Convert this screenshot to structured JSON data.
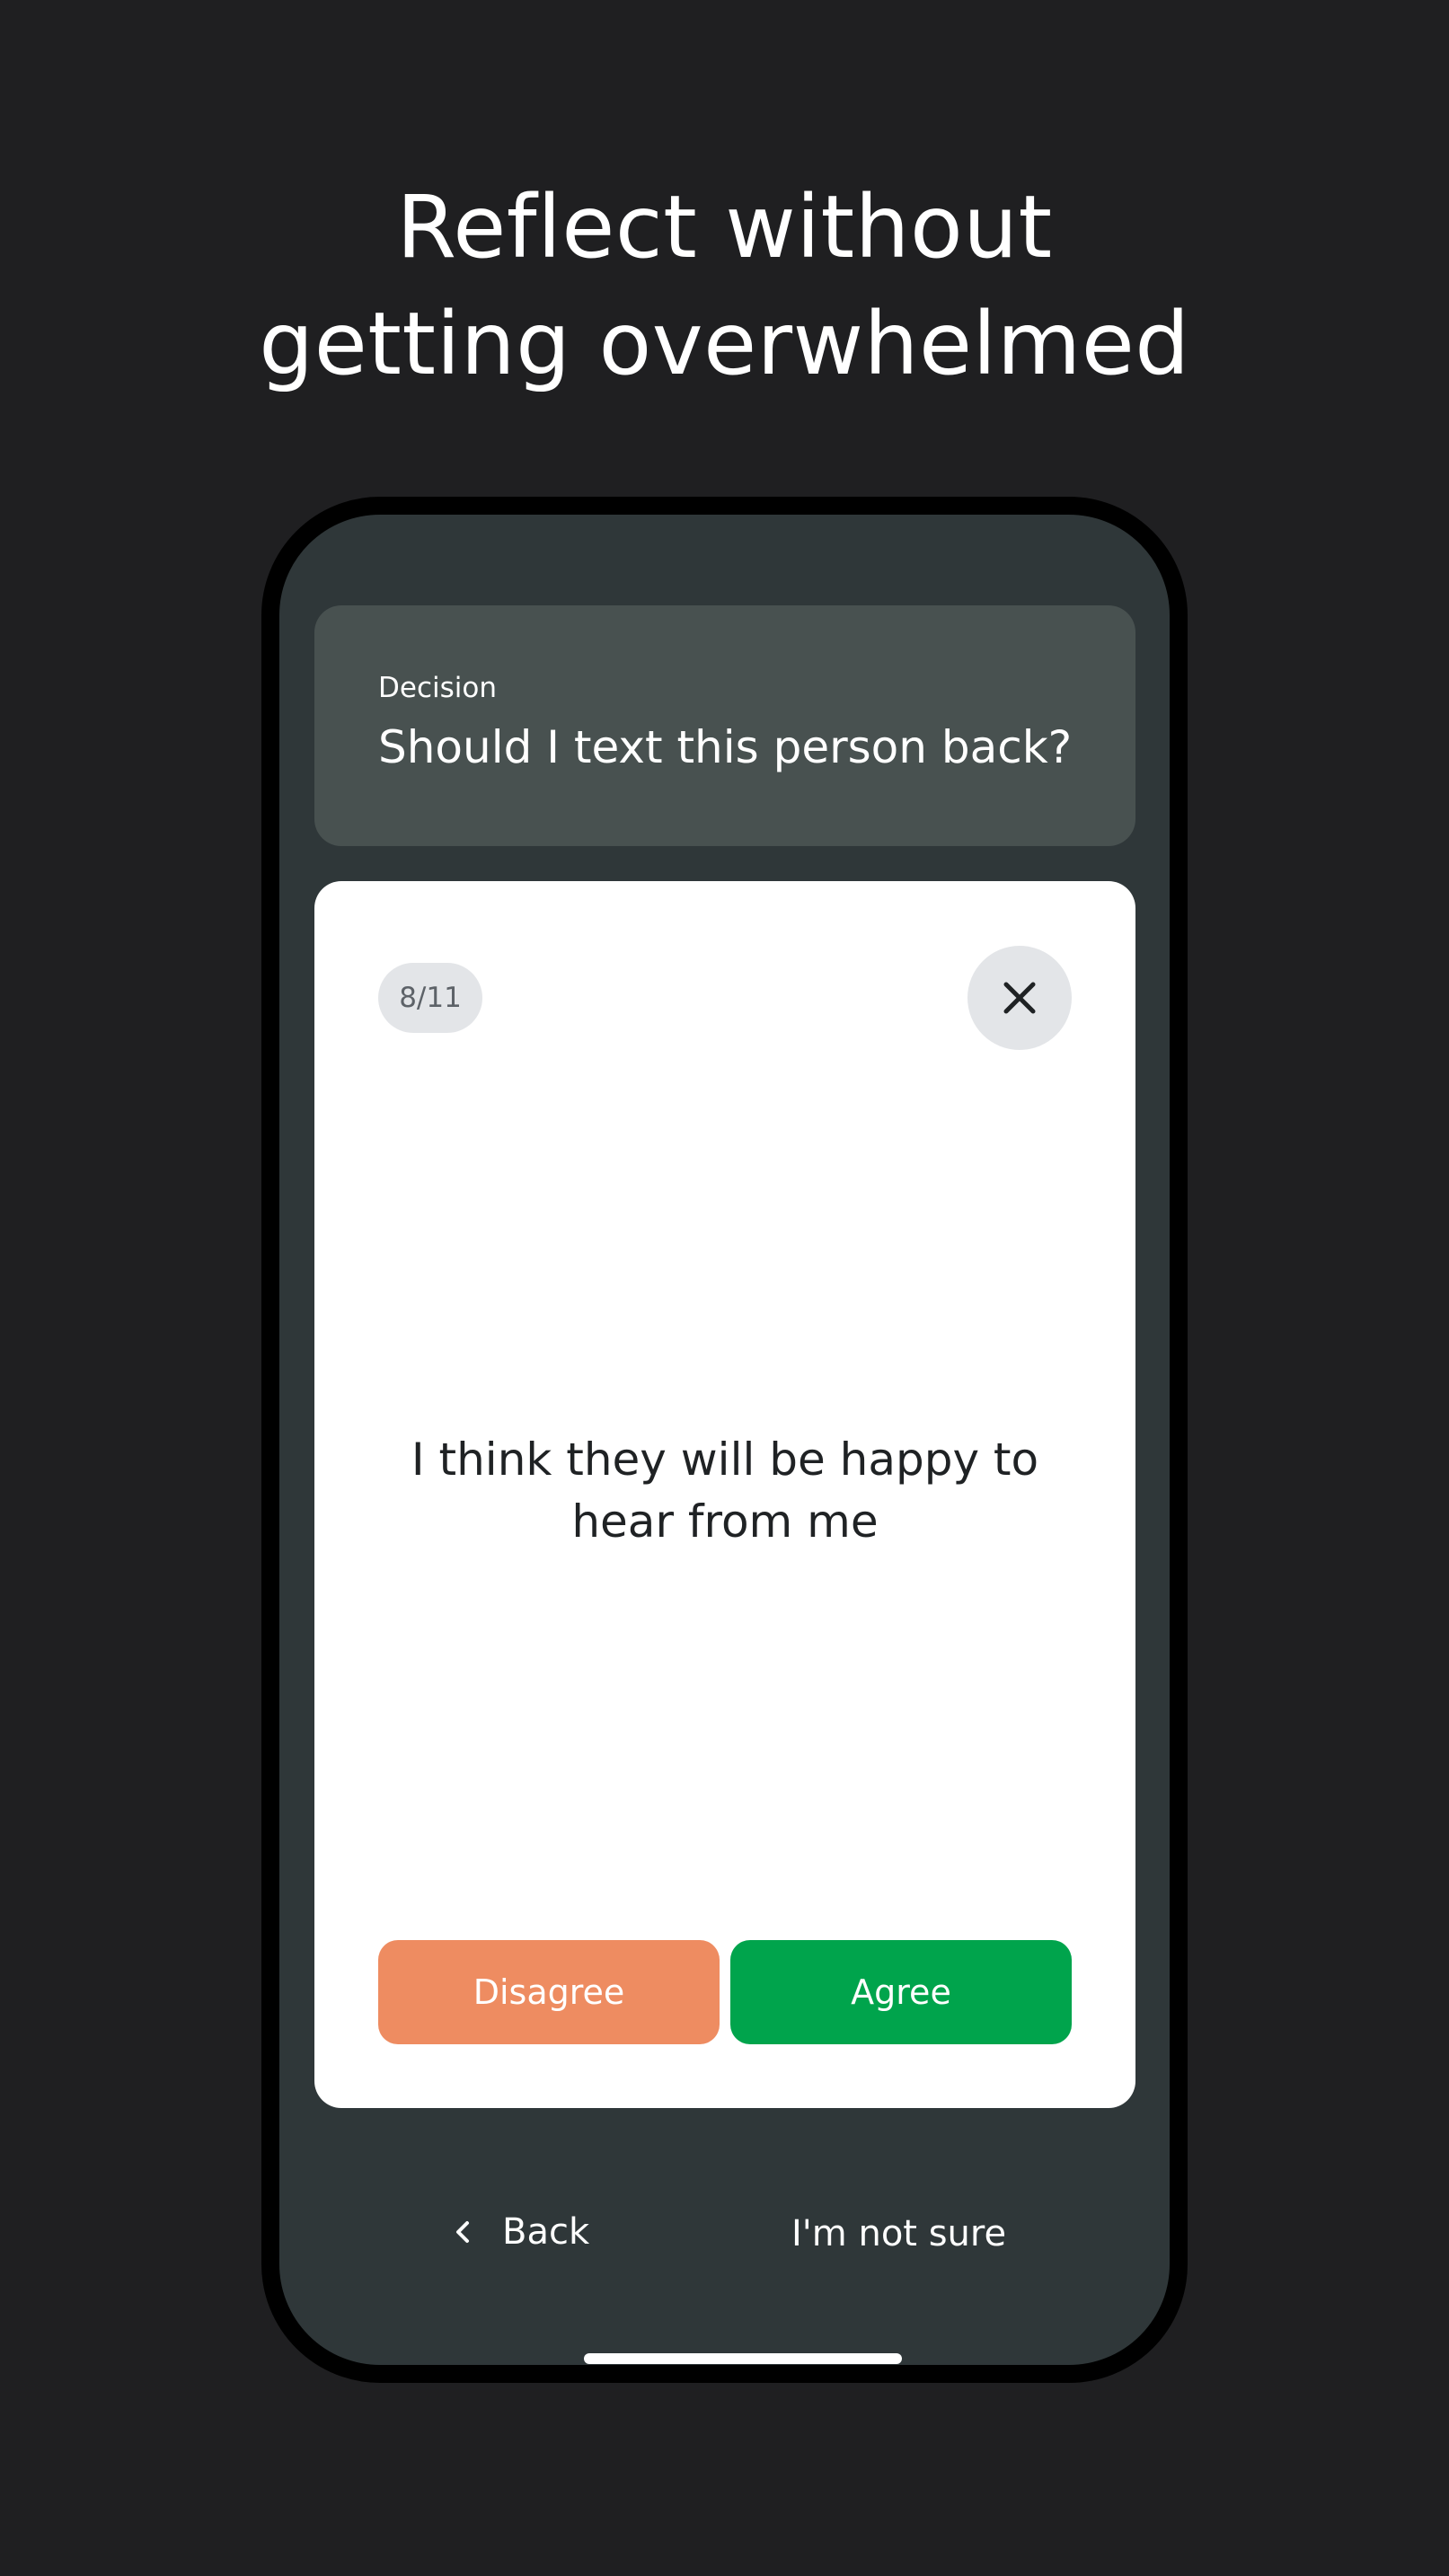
{
  "headline": {
    "line1": "Reflect without",
    "line2": "getting overwhelmed"
  },
  "decision": {
    "label": "Decision",
    "question": "Should I text this person back?"
  },
  "card": {
    "counter": "8/11",
    "statement": "I think they will be happy to hear from me",
    "close_icon": "close-icon"
  },
  "choices": {
    "disagree_label": "Disagree",
    "agree_label": "Agree",
    "disagree_color": "#ee8c61",
    "agree_color": "#00a44c"
  },
  "navigation": {
    "back_label": "Back",
    "back_icon": "chevron-left-icon",
    "not_sure_label": "I'm not sure"
  }
}
